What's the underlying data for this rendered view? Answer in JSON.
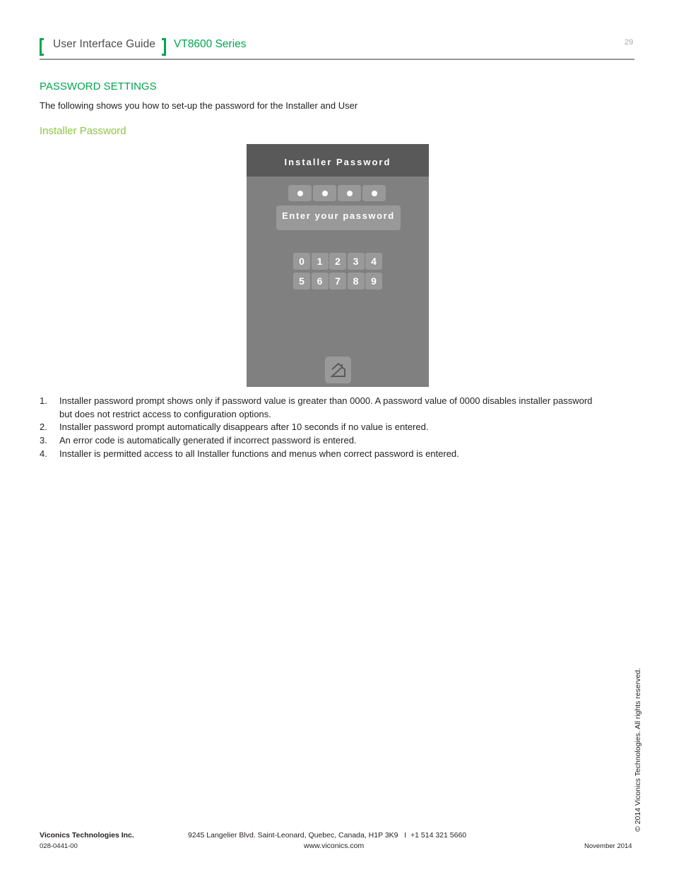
{
  "header": {
    "guide_title": "User Interface Guide",
    "series": "VT8600 Series",
    "page_number": "29",
    "accent_color": "#00a651"
  },
  "section": {
    "title": "PASSWORD SETTINGS",
    "intro": "The following shows you how to set-up the password for the Installer and User",
    "subtitle": "Installer Password",
    "subtitle_color": "#8dc63f"
  },
  "device_screen": {
    "title": "Installer Password",
    "password_dots": [
      "●",
      "●",
      "●",
      "●"
    ],
    "prompt": "Enter your password",
    "keys": [
      "0",
      "1",
      "2",
      "3",
      "4",
      "5",
      "6",
      "7",
      "8",
      "9"
    ],
    "home_icon": "home-icon"
  },
  "steps": [
    {
      "num": "1.",
      "text": "Installer password prompt shows only if password value is greater than 0000. A password value of 0000 disables installer password but does not restrict access to configuration options."
    },
    {
      "num": "2.",
      "text": "Installer password prompt automatically disappears after 10 seconds if no value is entered."
    },
    {
      "num": "3.",
      "text": "An error code is automatically generated if incorrect password is entered."
    },
    {
      "num": "4.",
      "text": "Installer is permitted access to all Installer functions and menus when correct password is entered."
    }
  ],
  "footer": {
    "company": "Viconics Technologies Inc.",
    "doc_number": "028-0441-00",
    "address": "9245 Langelier Blvd. Saint-Leonard, Quebec, Canada, H1P 3K9   I  +1 514 321 5660",
    "website": "www.viconics.com",
    "date": "November 2014",
    "copyright": "© 2014 Viconics Technologies. All rights reserved."
  }
}
